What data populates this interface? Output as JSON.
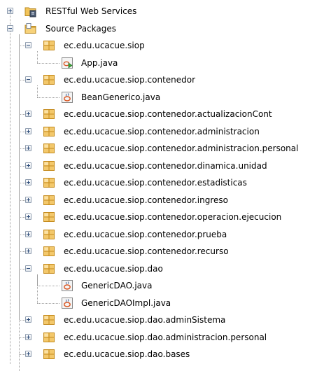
{
  "tree": {
    "nodes": [
      {
        "label": "RESTful Web Services",
        "depth": 0,
        "kind": "rest",
        "expanded": false
      },
      {
        "label": "Source Packages",
        "depth": 0,
        "kind": "source-folder",
        "expanded": true
      },
      {
        "label": "ec.edu.ucacue.siop",
        "depth": 1,
        "kind": "package",
        "expanded": true
      },
      {
        "label": "App.java",
        "depth": 2,
        "kind": "java-main"
      },
      {
        "label": "ec.edu.ucacue.siop.contenedor",
        "depth": 1,
        "kind": "package",
        "expanded": true
      },
      {
        "label": "BeanGenerico.java",
        "depth": 2,
        "kind": "java"
      },
      {
        "label": "ec.edu.ucacue.siop.contenedor.actualizacionCont",
        "depth": 1,
        "kind": "package",
        "expanded": false
      },
      {
        "label": "ec.edu.ucacue.siop.contenedor.administracion",
        "depth": 1,
        "kind": "package",
        "expanded": false
      },
      {
        "label": "ec.edu.ucacue.siop.contenedor.administracion.personal",
        "depth": 1,
        "kind": "package",
        "expanded": false
      },
      {
        "label": "ec.edu.ucacue.siop.contenedor.dinamica.unidad",
        "depth": 1,
        "kind": "package",
        "expanded": false
      },
      {
        "label": "ec.edu.ucacue.siop.contenedor.estadisticas",
        "depth": 1,
        "kind": "package",
        "expanded": false
      },
      {
        "label": "ec.edu.ucacue.siop.contenedor.ingreso",
        "depth": 1,
        "kind": "package",
        "expanded": false
      },
      {
        "label": "ec.edu.ucacue.siop.contenedor.operacion.ejecucion",
        "depth": 1,
        "kind": "package",
        "expanded": false
      },
      {
        "label": "ec.edu.ucacue.siop.contenedor.prueba",
        "depth": 1,
        "kind": "package",
        "expanded": false
      },
      {
        "label": "ec.edu.ucacue.siop.contenedor.recurso",
        "depth": 1,
        "kind": "package",
        "expanded": false
      },
      {
        "label": "ec.edu.ucacue.siop.dao",
        "depth": 1,
        "kind": "package",
        "expanded": true
      },
      {
        "label": "GenericDAO.java",
        "depth": 2,
        "kind": "java"
      },
      {
        "label": "GenericDAOImpl.java",
        "depth": 2,
        "kind": "java"
      },
      {
        "label": "ec.edu.ucacue.siop.dao.adminSistema",
        "depth": 1,
        "kind": "package",
        "expanded": false
      },
      {
        "label": "ec.edu.ucacue.siop.dao.administracion.personal",
        "depth": 1,
        "kind": "package",
        "expanded": false
      },
      {
        "label": "ec.edu.ucacue.siop.dao.bases",
        "depth": 1,
        "kind": "package",
        "expanded": false
      }
    ]
  },
  "icons": {
    "rest": "rest-services-icon",
    "source-folder": "source-folder-icon",
    "package": "package-icon",
    "java-main": "java-main-class-icon",
    "java": "java-class-icon"
  },
  "colors": {
    "package_fill": "#f3c86b",
    "package_border": "#c48a1c",
    "folder_fill": "#f2c45a",
    "tree_line": "#a0a0a0",
    "toggle_border": "#8e9cae",
    "java_accent": "#d9531e"
  }
}
